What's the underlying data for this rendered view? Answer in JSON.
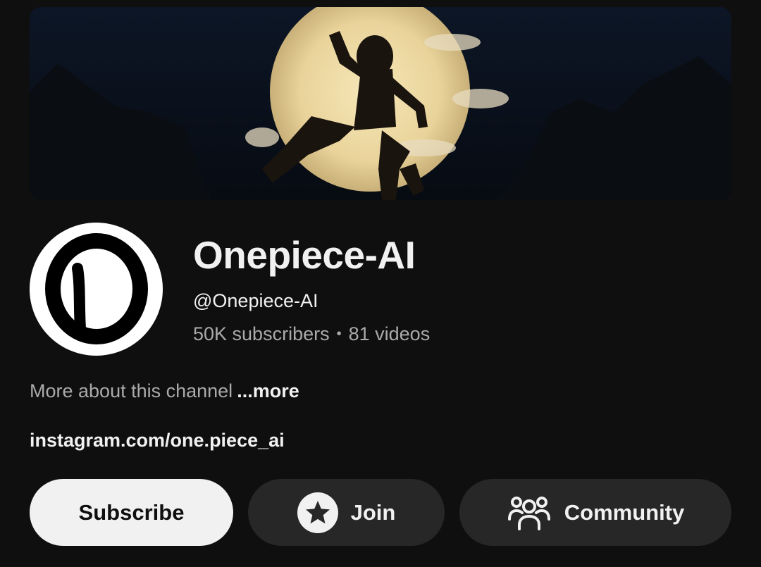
{
  "channel": {
    "name": "Onepiece-AI",
    "handle": "@Onepiece-AI",
    "subscribers": "50K subscribers",
    "separator": "•",
    "videos": "81 videos",
    "about_text": "More about this channel",
    "more_label": "...more",
    "link": "instagram.com/one.piece_ai"
  },
  "actions": {
    "subscribe_label": "Subscribe",
    "join_label": "Join",
    "community_label": "Community"
  },
  "icons": {
    "join": "star-icon",
    "community": "people-icon"
  },
  "colors": {
    "background": "#0f0f0f",
    "primary_text": "#f1f1f1",
    "secondary_text": "#aaaaaa",
    "subscribe_bg": "#f1f1f1",
    "button_bg": "#272727"
  }
}
